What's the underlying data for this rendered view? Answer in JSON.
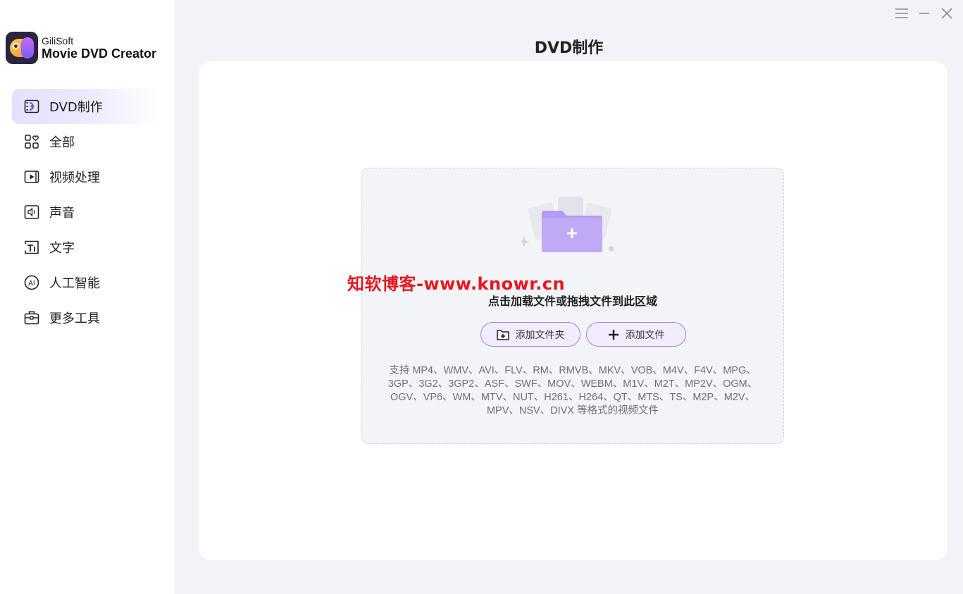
{
  "app": {
    "brand_small": "GiliSoft",
    "brand_name": "Movie DVD Creator"
  },
  "sidebar": {
    "items": [
      {
        "label": "DVD制作",
        "icon": "dvd-icon",
        "active": true
      },
      {
        "label": "全部",
        "icon": "grid-icon",
        "active": false
      },
      {
        "label": "视频处理",
        "icon": "video-play-icon",
        "active": false
      },
      {
        "label": "声音",
        "icon": "sound-icon",
        "active": false
      },
      {
        "label": "文字",
        "icon": "text-icon",
        "active": false
      },
      {
        "label": "人工智能",
        "icon": "ai-icon",
        "active": false
      },
      {
        "label": "更多工具",
        "icon": "toolbox-icon",
        "active": false
      }
    ]
  },
  "window_controls": [
    "menu-icon",
    "minimize-icon",
    "close-icon"
  ],
  "main": {
    "title": "DVD制作",
    "watermark": "知软博客-www.knowr.cn",
    "drop_hint": "点击加载文件或拖拽文件到此区域",
    "add_folder_label": "添加文件夹",
    "add_file_label": "添加文件",
    "formats_lines": [
      "支持 MP4、WMV、AVI、FLV、RM、RMVB、MKV、VOB、M4V、F4V、MPG、",
      "3GP、3G2、3GP2、ASF、SWF、MOV、WEBM、M1V、M2T、MP2V、OGM、",
      "OGV、VP6、WM、MTV、NUT、H261、H264、QT、MTS、TS、M2P、M2V、",
      "MPV、NSV、DIVX 等格式的视频文件"
    ]
  },
  "colors": {
    "accent": "#8b6cf0",
    "active_bg": "#e5e0ff",
    "watermark": "#e8161e",
    "background": "#f2f3f8"
  }
}
